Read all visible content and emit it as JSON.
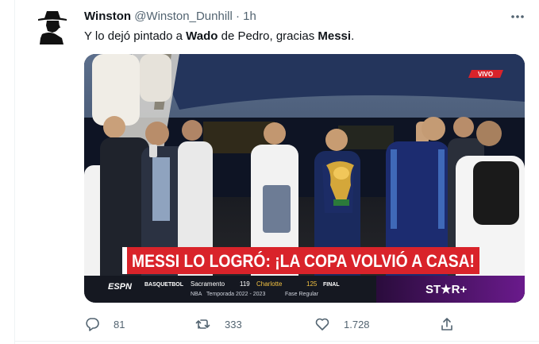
{
  "tweet": {
    "author_name": "Winston",
    "author_handle": "@Winston_Dunhill",
    "separator": "·",
    "time": "1h",
    "text_parts": [
      "Y lo dejó pintado a ",
      "Wado",
      " de Pedro, gracias ",
      "Messi",
      "."
    ]
  },
  "media": {
    "live_badge": "VIVO",
    "headline": "MESSI LO LOGRÓ: ¡LA COPA VOLVIÓ A CASA!",
    "network_logo": "ESPN",
    "ticker": {
      "sport": "BASQUETBOL",
      "team1": "Sacramento",
      "score1": "119",
      "team2": "Charlotte",
      "score2": "125",
      "status": "FINAL",
      "league": "NBA",
      "season": "Temporada 2022 - 2023",
      "phase": "Fase Regular"
    },
    "channel_logo": "ST★R+"
  },
  "actions": {
    "replies": "81",
    "retweets": "333",
    "likes": "1.728"
  },
  "colors": {
    "banner_red": "#d9232a",
    "ticker_purple": "#6a1a8c",
    "text_secondary": "#536471"
  }
}
